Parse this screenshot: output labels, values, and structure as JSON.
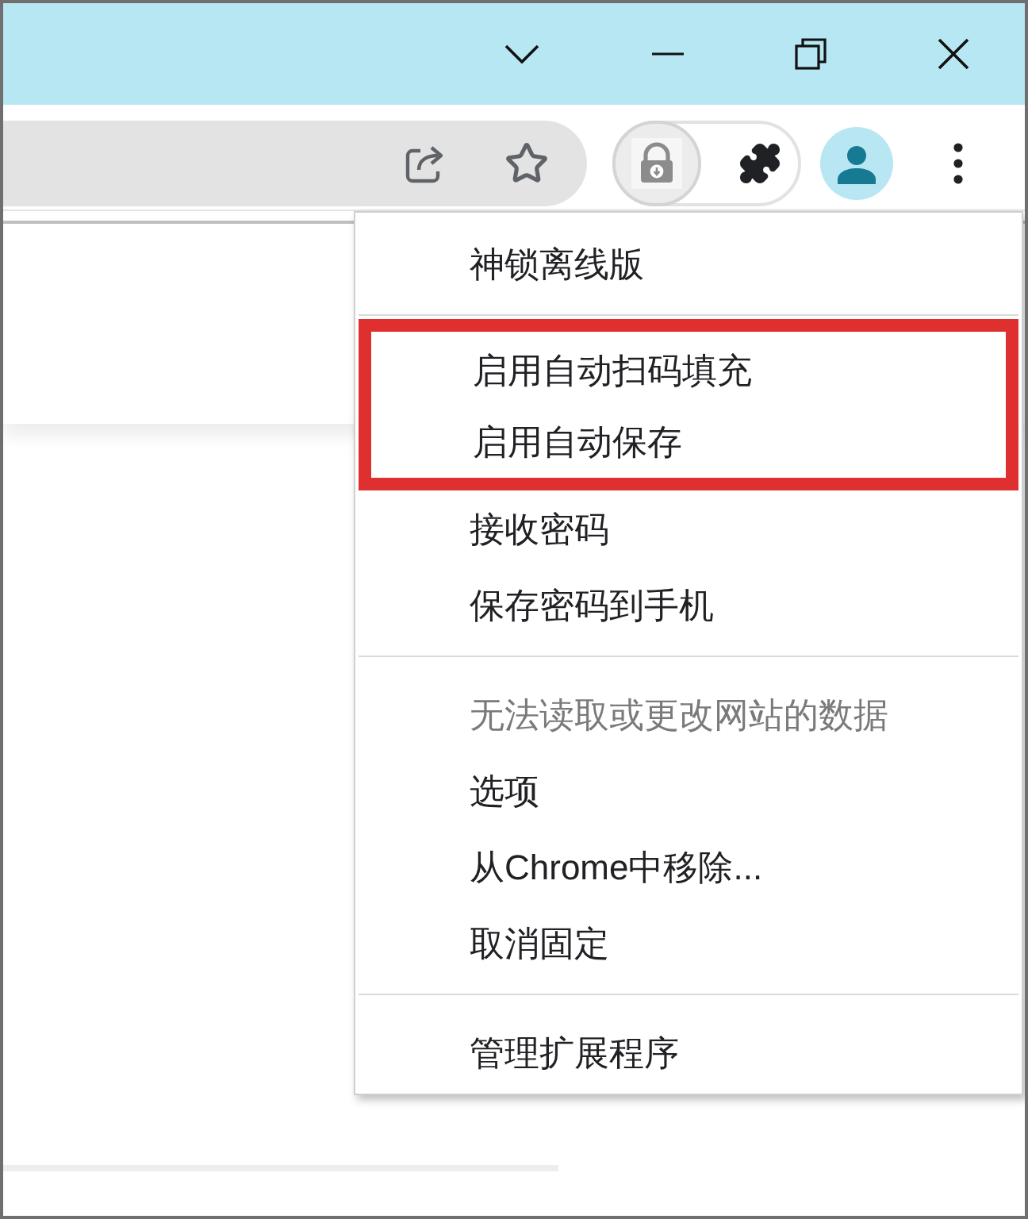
{
  "toolbar": {
    "pinned_extension": {
      "active": true
    }
  },
  "menu": {
    "sections": [
      {
        "items": [
          {
            "label": "神锁离线版",
            "disabled": false,
            "highlighted": false
          }
        ]
      },
      {
        "items": [
          {
            "label": "启用自动扫码填充",
            "disabled": false,
            "highlighted": true
          },
          {
            "label": "启用自动保存",
            "disabled": false,
            "highlighted": true
          },
          {
            "label": "接收密码",
            "disabled": false,
            "highlighted": false
          },
          {
            "label": "保存密码到手机",
            "disabled": false,
            "highlighted": false
          }
        ]
      },
      {
        "items": [
          {
            "label": "无法读取或更改网站的数据",
            "disabled": true,
            "highlighted": false
          },
          {
            "label": "选项",
            "disabled": false,
            "highlighted": false
          },
          {
            "label": "从Chrome中移除...",
            "disabled": false,
            "highlighted": false
          },
          {
            "label": "取消固定",
            "disabled": false,
            "highlighted": false
          }
        ]
      },
      {
        "items": [
          {
            "label": "管理扩展程序",
            "disabled": false,
            "highlighted": false
          }
        ]
      }
    ]
  }
}
